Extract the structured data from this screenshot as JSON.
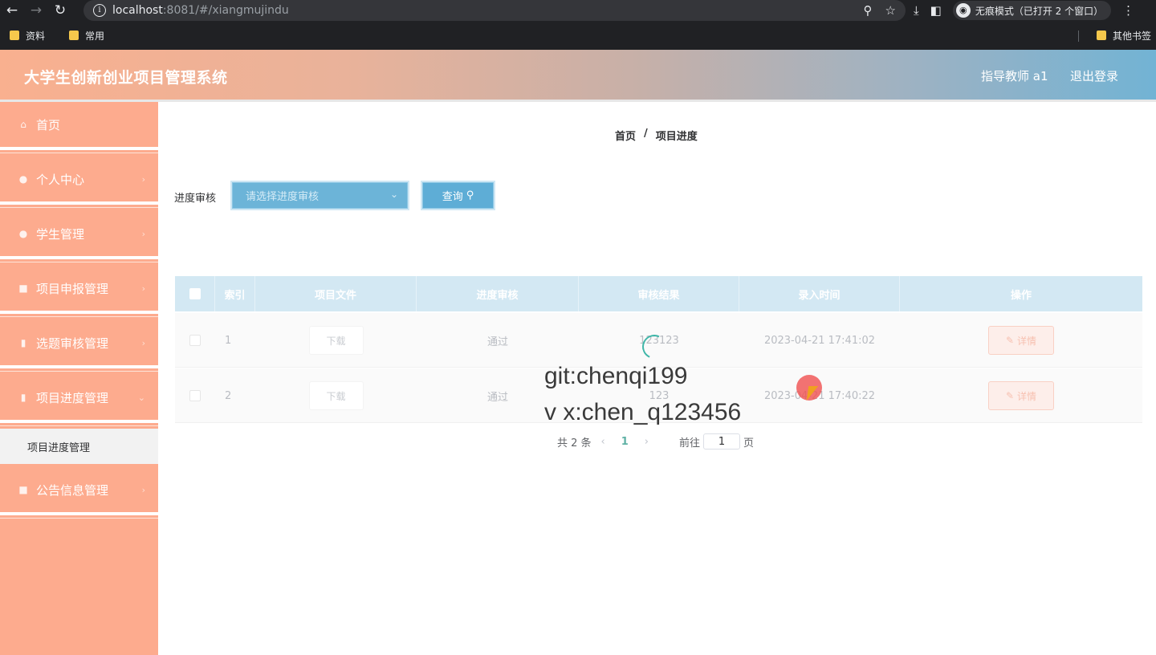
{
  "browser": {
    "url_host": "localhost",
    "url_path": ":8081/#/xiangmujindu",
    "incognito_label": "无痕模式（已打开 2 个窗口）",
    "bookmarks": [
      "资料",
      "常用"
    ],
    "other_bookmarks": "其他书签"
  },
  "header": {
    "title": "大学生创新创业项目管理系统",
    "user": "指导教师 a1",
    "logout": "退出登录"
  },
  "sidebar": {
    "items": [
      {
        "label": "首页",
        "icon": "home-icon"
      },
      {
        "label": "个人中心",
        "icon": "user-icon"
      },
      {
        "label": "学生管理",
        "icon": "student-icon"
      },
      {
        "label": "项目申报管理",
        "icon": "document-icon"
      },
      {
        "label": "选题审核管理",
        "icon": "chart-icon"
      },
      {
        "label": "项目进度管理",
        "icon": "progress-icon"
      },
      {
        "label": "公告信息管理",
        "icon": "notice-icon"
      }
    ],
    "active_sub": "项目进度管理"
  },
  "breadcrumb": {
    "home": "首页",
    "sep": "/",
    "current": "项目进度"
  },
  "filter": {
    "label": "进度审核",
    "placeholder": "请选择进度审核",
    "query_label": "查询"
  },
  "table": {
    "columns": [
      "索引",
      "项目文件",
      "进度审核",
      "审核结果",
      "录入时间",
      "操作"
    ],
    "rows": [
      {
        "index": "1",
        "file": "下载",
        "status": "通过",
        "result": "123123",
        "time": "2023-04-21 17:41:02",
        "action": "详情"
      },
      {
        "index": "2",
        "file": "下载",
        "status": "通过",
        "result": "123",
        "time": "2023-04-21 17:40:22",
        "action": "详情"
      }
    ]
  },
  "pagination": {
    "total": "共 2 条",
    "current": "1",
    "goto_label": "前往",
    "page_input": "1",
    "page_suffix": "页"
  },
  "overlay": {
    "line1": "git:chenqi199",
    "line2": "v x:chen_q123456"
  }
}
